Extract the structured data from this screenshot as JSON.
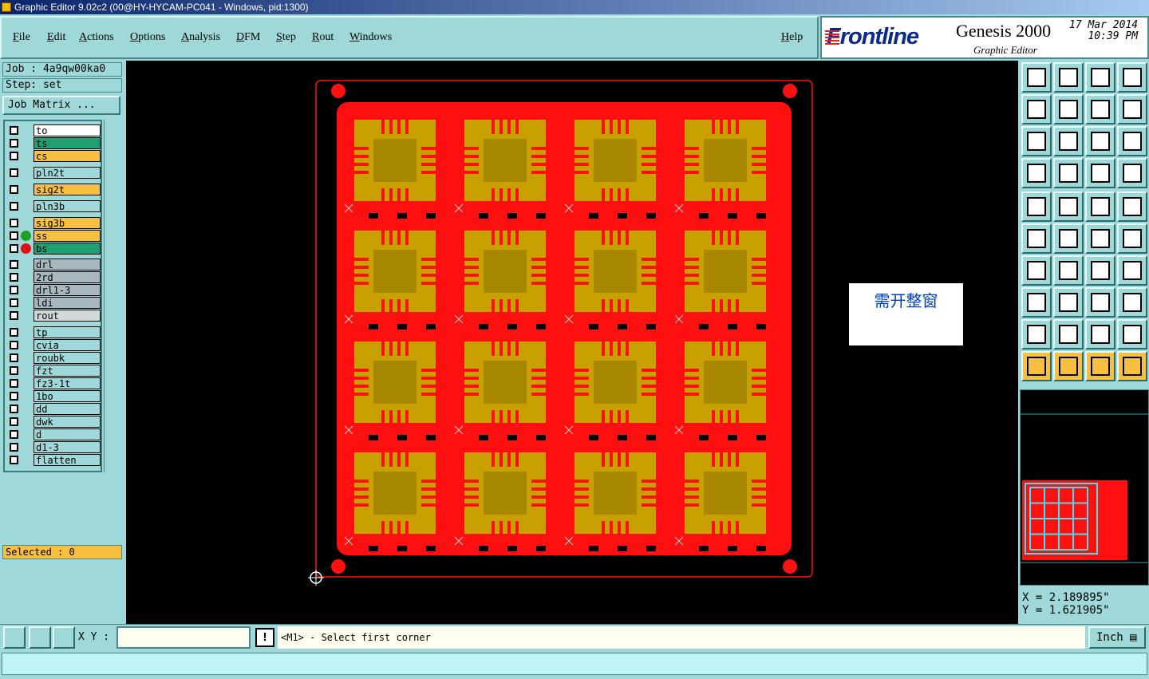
{
  "window": {
    "title": "Graphic Editor 9.02c2 (00@HY-HYCAM-PC041 - Windows, pid:1300)"
  },
  "menu": {
    "items": [
      "File",
      "Edit",
      "Actions",
      "Options",
      "Analysis",
      "DFM",
      "Step",
      "Rout",
      "Windows"
    ],
    "help": "Help"
  },
  "brand": {
    "logo": "Frontline",
    "product": "Genesis 2000",
    "subtitle": "Graphic Editor",
    "date": "17 Mar 2014",
    "time": "10:39 PM"
  },
  "job": {
    "job_label": "Job : 4a9qw00ka0",
    "step_label": "Step: set",
    "matrix_button": "Job Matrix ..."
  },
  "layers": [
    {
      "name": "to",
      "color": "#ffffff",
      "dot": ""
    },
    {
      "name": "ts",
      "color": "#20a070",
      "dot": ""
    },
    {
      "name": "cs",
      "color": "#f8c040",
      "dot": ""
    },
    {
      "name": "pln2t",
      "color": "#9ed8d8",
      "dot": ""
    },
    {
      "name": "sig2t",
      "color": "#f8c040",
      "dot": ""
    },
    {
      "name": "pln3b",
      "color": "#9ed8d8",
      "dot": ""
    },
    {
      "name": "sig3b",
      "color": "#f8c040",
      "dot": ""
    },
    {
      "name": "ss",
      "color": "#f8c040",
      "dot": "#20a020"
    },
    {
      "name": "bs",
      "color": "#20a070",
      "dot": "#e01010"
    },
    {
      "name": "drl",
      "color": "#a8b8c0",
      "dot": ""
    },
    {
      "name": "2rd",
      "color": "#a8b8c0",
      "dot": ""
    },
    {
      "name": "drl1-3",
      "color": "#a8b8c0",
      "dot": ""
    },
    {
      "name": "ldi",
      "color": "#a8b8c0",
      "dot": ""
    },
    {
      "name": "rout",
      "color": "#d0d8d8",
      "dot": ""
    },
    {
      "name": "tp",
      "color": "#9ed8d8",
      "dot": ""
    },
    {
      "name": "cvia",
      "color": "#9ed8d8",
      "dot": ""
    },
    {
      "name": "roubk",
      "color": "#9ed8d8",
      "dot": ""
    },
    {
      "name": "fzt",
      "color": "#9ed8d8",
      "dot": ""
    },
    {
      "name": "fz3-1t",
      "color": "#9ed8d8",
      "dot": ""
    },
    {
      "name": "1bo",
      "color": "#9ed8d8",
      "dot": ""
    },
    {
      "name": "dd",
      "color": "#9ed8d8",
      "dot": ""
    },
    {
      "name": "dwk",
      "color": "#9ed8d8",
      "dot": ""
    },
    {
      "name": "d",
      "color": "#9ed8d8",
      "dot": ""
    },
    {
      "name": "d1-3",
      "color": "#9ed8d8",
      "dot": ""
    },
    {
      "name": "flatten",
      "color": "#9ed8d8",
      "dot": ""
    }
  ],
  "selected": "Selected : 0",
  "canvas": {
    "note": "需开整窗",
    "board_color": "#ff1010",
    "copper_color": "#c8a000"
  },
  "coords": {
    "x": "X = 2.189895\"",
    "y": "Y = 1.621905\""
  },
  "bottom": {
    "xy_label": "X Y :",
    "xy_value": "",
    "prompt": "<M1> - Select first corner",
    "unit": "Inch"
  }
}
